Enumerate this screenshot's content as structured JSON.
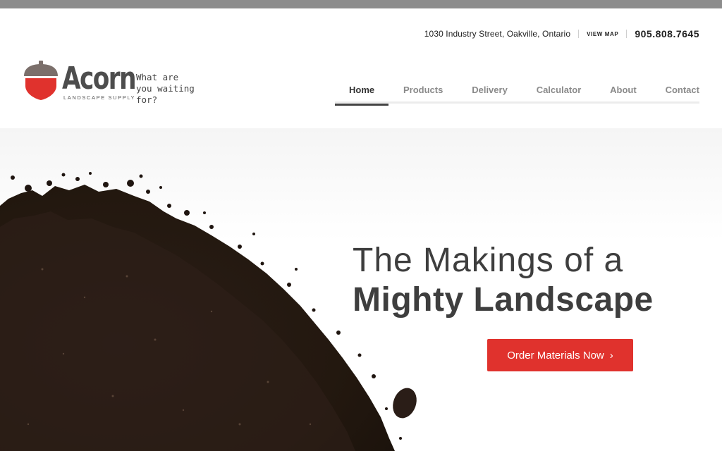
{
  "header": {
    "address": "1030 Industry Street, Oakville, Ontario",
    "map_link": "VIEW MAP",
    "phone": "905.808.7645"
  },
  "logo": {
    "name": "Acorn",
    "subtitle": "LANDSCAPE SUPPLY",
    "tagline": "What are you waiting for?",
    "colors": {
      "cap": "#7b6f6b",
      "body": "#e0322d"
    }
  },
  "nav": {
    "items": [
      {
        "label": "Home",
        "active": true
      },
      {
        "label": "Products",
        "active": false
      },
      {
        "label": "Delivery",
        "active": false
      },
      {
        "label": "Calculator",
        "active": false
      },
      {
        "label": "About",
        "active": false
      },
      {
        "label": "Contact",
        "active": false
      }
    ]
  },
  "hero": {
    "headline_line1": "The Makings of a",
    "headline_line2": "Mighty Landscape",
    "cta_label": "Order Materials Now",
    "cta_icon": "chevron-right-icon",
    "cta_glyph": "›",
    "accent_color": "#e0322d"
  }
}
